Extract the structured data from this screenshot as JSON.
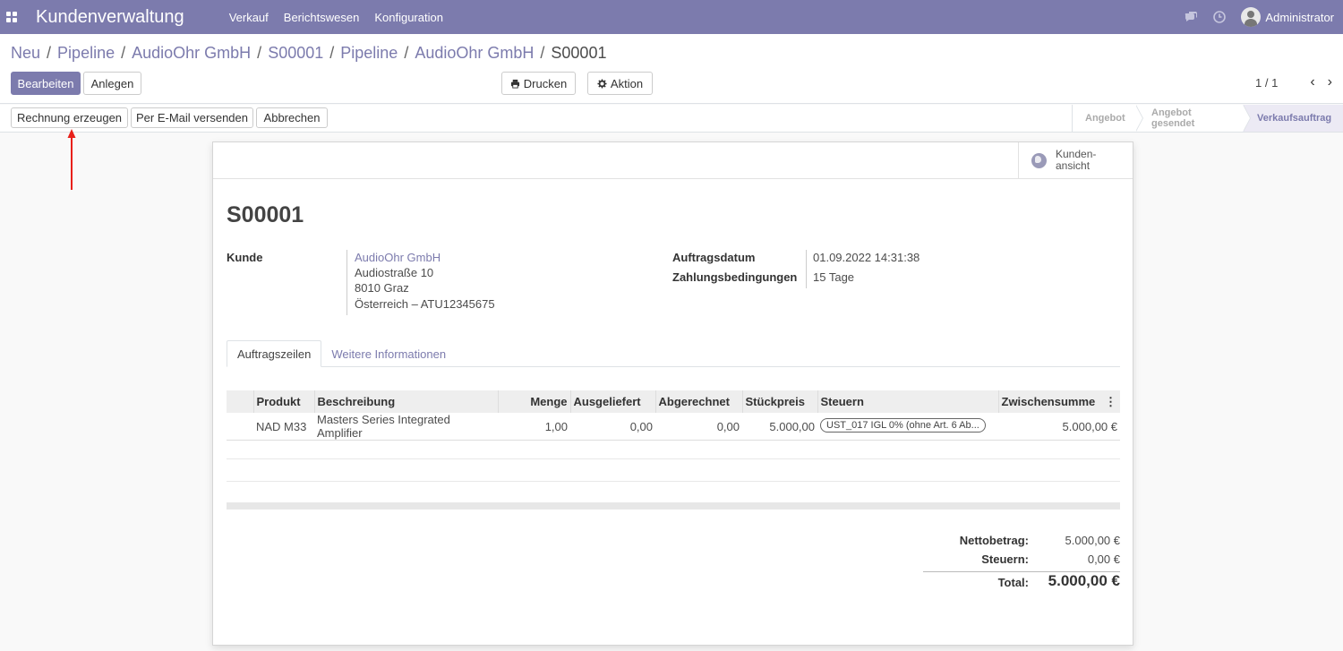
{
  "navbar": {
    "app_title": "Kundenverwaltung",
    "menu": [
      "Verkauf",
      "Berichtswesen",
      "Konfiguration"
    ],
    "user": "Administrator"
  },
  "breadcrumb": [
    "Neu",
    "Pipeline",
    "AudioOhr GmbH",
    "S00001",
    "Pipeline",
    "AudioOhr GmbH",
    "S00001"
  ],
  "actions": {
    "edit": "Bearbeiten",
    "create": "Anlegen",
    "print": "Drucken",
    "action": "Aktion"
  },
  "pager": {
    "value": "1 / 1",
    "prev": "‹",
    "next": "›"
  },
  "status_buttons": {
    "invoice": "Rechnung erzeugen",
    "email": "Per E-Mail versenden",
    "cancel": "Abbrechen"
  },
  "stages": [
    "Angebot",
    "Angebot gesendet",
    "Verkaufsauftrag"
  ],
  "active_stage": "Verkaufsauftrag",
  "smart_button": {
    "line1": "Kunden-",
    "line2": "ansicht"
  },
  "order": {
    "name": "S00001",
    "customer_label": "Kunde",
    "customer_name": "AudioOhr GmbH",
    "customer_address": [
      "Audiostraße 10",
      "8010 Graz",
      "Österreich – ATU12345675"
    ],
    "date_label": "Auftragsdatum",
    "date_value": "01.09.2022 14:31:38",
    "terms_label": "Zahlungsbedingungen",
    "terms_value": "15 Tage"
  },
  "tabs": [
    "Auftragszeilen",
    "Weitere Informationen"
  ],
  "lines": {
    "columns": [
      "Produkt",
      "Beschreibung",
      "Menge",
      "Ausgeliefert",
      "Abgerechnet",
      "Stückpreis",
      "Steuern",
      "Zwischensumme"
    ],
    "rows": [
      {
        "product": "NAD M33",
        "description": "Masters Series Integrated Amplifier",
        "qty": "1,00",
        "delivered": "0,00",
        "invoiced": "0,00",
        "unit_price": "5.000,00",
        "tax": "UST_017 IGL 0% (ohne Art. 6 Ab...",
        "subtotal": "5.000,00 €"
      }
    ]
  },
  "totals": {
    "net_label": "Nettobetrag:",
    "net_value": "5.000,00 €",
    "tax_label": "Steuern:",
    "tax_value": "0,00 €",
    "total_label": "Total:",
    "total_value": "5.000,00 €"
  },
  "colors": {
    "brand": "#7c7bad",
    "annotation": "#e8201a"
  }
}
